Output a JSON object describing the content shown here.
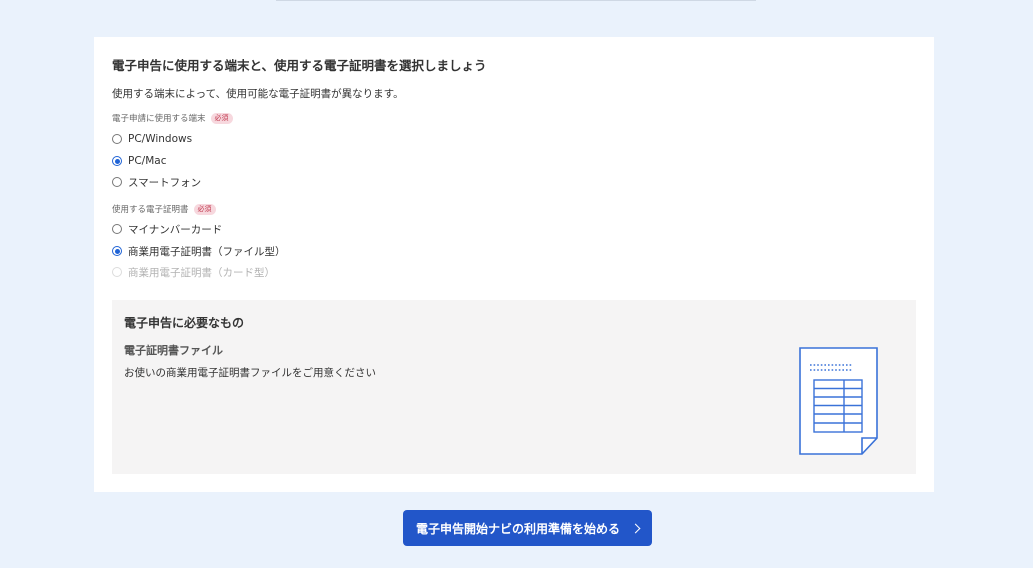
{
  "card": {
    "title": "電子申告に使用する端末と、使用する電子証明書を選択しましょう",
    "description": "使用する端末によって、使用可能な電子証明書が異なります。"
  },
  "device_group": {
    "label": "電子申請に使用する端末",
    "badge": "必須",
    "options": [
      {
        "label": "PC/Windows",
        "checked": false,
        "disabled": false
      },
      {
        "label": "PC/Mac",
        "checked": true,
        "disabled": false
      },
      {
        "label": "スマートフォン",
        "checked": false,
        "disabled": false
      }
    ]
  },
  "cert_group": {
    "label": "使用する電子証明書",
    "badge": "必須",
    "options": [
      {
        "label": "マイナンバーカード",
        "checked": false,
        "disabled": false
      },
      {
        "label": "商業用電子証明書（ファイル型）",
        "checked": true,
        "disabled": false
      },
      {
        "label": "商業用電子証明書（カード型）",
        "checked": false,
        "disabled": true
      }
    ]
  },
  "requirements": {
    "title": "電子申告に必要なもの",
    "item_title": "電子証明書ファイル",
    "item_desc": "お使いの商業用電子証明書ファイルをご用意ください"
  },
  "cta": {
    "label": "電子申告開始ナビの利用準備を始める"
  },
  "colors": {
    "accent": "#2256c9",
    "page_background": "#eaf2fc",
    "badge_bg": "#f7d8de",
    "badge_text": "#c0394f"
  },
  "icons": {
    "document": "document-table-icon",
    "arrow": "chevron-right-icon"
  }
}
